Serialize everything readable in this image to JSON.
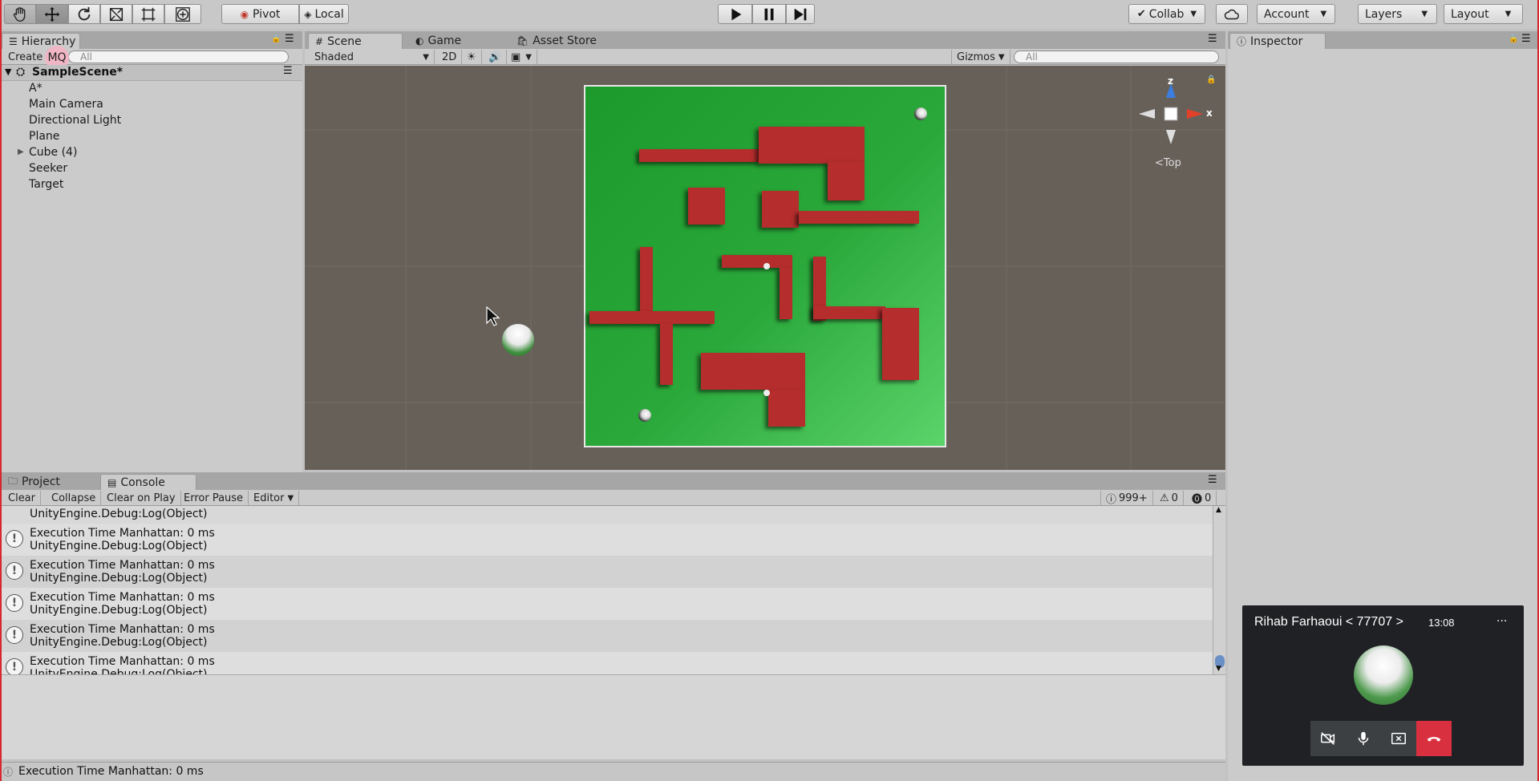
{
  "toolbar": {
    "pivot_label": "Pivot",
    "local_label": "Local",
    "collab_label": "Collab",
    "account_label": "Account",
    "layers_label": "Layers",
    "layout_label": "Layout"
  },
  "hierarchy": {
    "tab_label": "Hierarchy",
    "create_label": "Create",
    "search_placeholder": "All",
    "avatar_initials": "MQ",
    "scene_name": "SampleScene*",
    "items": [
      "A*",
      "Main Camera",
      "Directional Light",
      "Plane",
      "Cube (4)",
      "Seeker",
      "Target"
    ]
  },
  "scene": {
    "tabs": [
      "Scene",
      "Game",
      "Asset Store"
    ],
    "shading_mode": "Shaded",
    "mode_2d_label": "2D",
    "gizmos_label": "Gizmos",
    "search_placeholder": "All",
    "view_label": "Top",
    "axis_labels": {
      "z": "z",
      "x": "x"
    }
  },
  "inspector": {
    "tab_label": "Inspector"
  },
  "console": {
    "tabs": [
      "Project",
      "Console"
    ],
    "buttons": [
      "Clear",
      "Collapse",
      "Clear on Play",
      "Error Pause",
      "Editor"
    ],
    "counts": {
      "info": "999+",
      "warnings": "0",
      "errors": "0"
    },
    "partial_first_line": "UnityEngine.Debug:Log(Object)",
    "entries": [
      {
        "message": "Execution Time Manhattan: 0 ms",
        "trace": "UnityEngine.Debug:Log(Object)"
      },
      {
        "message": "Execution Time Manhattan: 0 ms",
        "trace": "UnityEngine.Debug:Log(Object)"
      },
      {
        "message": "Execution Time Manhattan: 0 ms",
        "trace": "UnityEngine.Debug:Log(Object)"
      },
      {
        "message": "Execution Time Manhattan: 0 ms",
        "trace": "UnityEngine.Debug:Log(Object)"
      },
      {
        "message": "Execution Time Manhattan: 0 ms",
        "trace": "UnityEngine.Debug:Log(Object)"
      }
    ]
  },
  "status_bar": {
    "message": "Execution Time Manhattan: 0 ms"
  },
  "call": {
    "caller_name": "Rihab Farhaoui < 77707 >",
    "time": "13:08",
    "more_label": "..."
  },
  "colors": {
    "floor_green": "#22a332",
    "wall_red": "#b52d2d",
    "hang_up_red": "#d93040",
    "scene_background": "#676059"
  }
}
